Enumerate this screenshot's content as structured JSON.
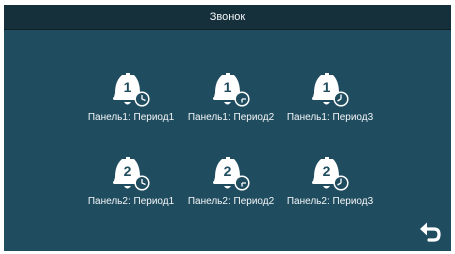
{
  "header": {
    "title": "Звонок"
  },
  "tiles": [
    {
      "label": "Панель1: Период1",
      "panel_number": "1",
      "icon": "bell-clock-icon"
    },
    {
      "label": "Панель1: Период2",
      "panel_number": "1",
      "icon": "bell-clock-icon"
    },
    {
      "label": "Панель1: Период3",
      "panel_number": "1",
      "icon": "bell-clock-icon"
    },
    {
      "label": "Панель2: Период1",
      "panel_number": "2",
      "icon": "bell-clock-icon"
    },
    {
      "label": "Панель2: Период2",
      "panel_number": "2",
      "icon": "bell-clock-icon"
    },
    {
      "label": "Панель2: Период3",
      "panel_number": "2",
      "icon": "bell-clock-icon"
    }
  ],
  "back_button": {
    "icon": "back-arrow-icon"
  },
  "colors": {
    "background": "#1f4c5f",
    "title_bar": "#16303b",
    "icon": "#ffffff",
    "text": "#f4f7f8"
  }
}
